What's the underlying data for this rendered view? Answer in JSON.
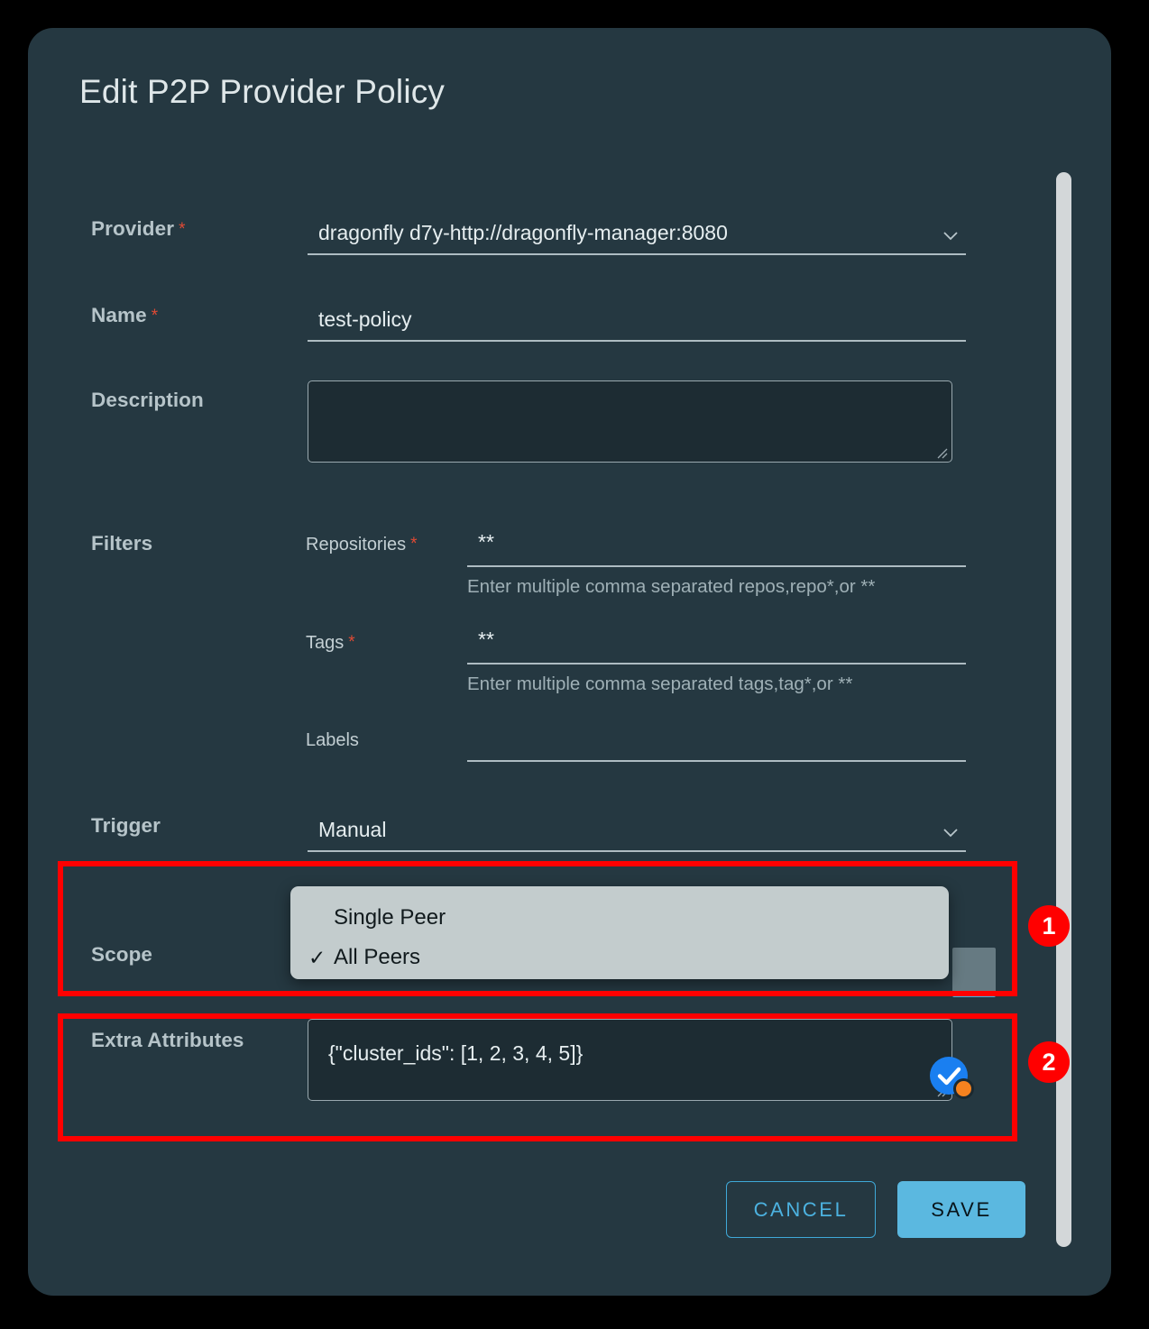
{
  "dialog": {
    "title": "Edit P2P Provider Policy"
  },
  "fields": {
    "provider": {
      "label": "Provider",
      "required": "*",
      "value": "dragonfly d7y-http://dragonfly-manager:8080",
      "chevron_icon": "chevron-down-icon"
    },
    "name": {
      "label": "Name",
      "required": "*",
      "value": "test-policy"
    },
    "description": {
      "label": "Description",
      "value": ""
    },
    "filters": {
      "label": "Filters",
      "repositories": {
        "label": "Repositories",
        "required": "*",
        "value": "**",
        "hint": "Enter multiple comma separated repos,repo*,or **"
      },
      "tags": {
        "label": "Tags",
        "required": "*",
        "value": "**",
        "hint": "Enter multiple comma separated tags,tag*,or **"
      },
      "labels": {
        "label": "Labels",
        "value": ""
      }
    },
    "trigger": {
      "label": "Trigger",
      "value": "Manual",
      "chevron_icon": "chevron-down-icon"
    },
    "scope": {
      "label": "Scope",
      "options": [
        {
          "label": "Single Peer",
          "checked": false,
          "check_glyph": ""
        },
        {
          "label": "All Peers",
          "checked": true,
          "check_glyph": "✓"
        }
      ]
    },
    "extra_attributes": {
      "label": "Extra Attributes",
      "value": "{\"cluster_ids\": [1, 2, 3, 4, 5]}"
    }
  },
  "actions": {
    "cancel_label": "CANCEL",
    "save_label": "SAVE"
  },
  "annotations": [
    {
      "number": "1",
      "target": "scope-dropdown"
    },
    {
      "number": "2",
      "target": "extra-attributes"
    }
  ],
  "colors": {
    "dialog_bg": "#253841",
    "accent": "#5bb8e0",
    "required_star": "#e04a34",
    "annotation_red": "#ff0000",
    "dropdown_bg": "#c3cccd",
    "cursor_blue": "#1a7ff0",
    "cursor_orange": "#f5821f"
  }
}
